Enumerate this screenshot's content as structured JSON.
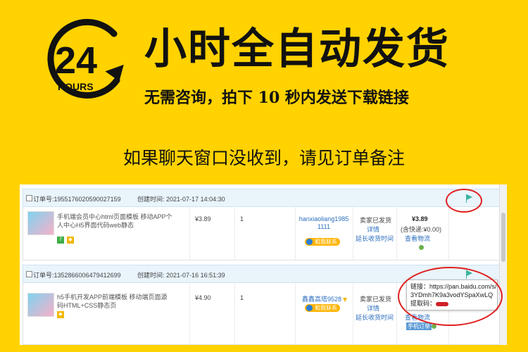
{
  "header": {
    "logo_number": "24",
    "logo_word": "HOURS",
    "headline": "小时全自动发货",
    "subline": "无需咨询，拍下 10 秒内发送下载链接",
    "note": "如果聊天窗口没收到，请见订单备注"
  },
  "orders": [
    {
      "order_label": "订单号:",
      "order_no": "1955176020590027159",
      "created_label": "创建时间:",
      "created_time": "2021-07-17 14:04:30",
      "product": "手机端会员中心html页面模板 移动APP个人中心H5界面代码web静态",
      "unit_price": "¥3.89",
      "quantity": "1",
      "buyer": "hanxiaoliang19851111",
      "contact_label": "和我联系",
      "status": "卖家已发货",
      "detail_link": "详情",
      "extend_link": "延长收货时间",
      "total": "¥3.89",
      "shipping_note": "(含快递:¥0.00)",
      "logistics_link": "查看物流"
    },
    {
      "order_label": "订单号:",
      "order_no": "1352866006479412699",
      "created_label": "创建时间:",
      "created_time": "2021-07-16 16:51:39",
      "product": "h5手机开发APP前端模板 移动端页面源码HTML+CSS静态页",
      "unit_price": "¥4.90",
      "quantity": "1",
      "buyer": "鑫鑫高塔9528",
      "contact_label": "和我联系",
      "status": "卖家已发货",
      "detail_link": "详情",
      "extend_link": "延长收货时间",
      "logistics_link": "查看物流",
      "extra_button": "手机订单"
    }
  ],
  "popup": {
    "link_label": "链接：",
    "link_url": "https://pan.baidu.com/s/1_3YDmh7K9a3vodYSpaXwLQ",
    "line1": "链接：https://pan.baidu.com/s/1_",
    "line2": "3YDmh7K9a3vodYSpaXwLQ",
    "code_label": "提取码："
  },
  "colors": {
    "background": "#ffd200",
    "text": "#111111",
    "link": "#2c6fbf",
    "highlight_circle": "#e02020",
    "flag": "#3bb5a0"
  },
  "icons": [
    "clock-arrow-icon",
    "flag-icon",
    "wangwang-chat-icon",
    "logistics-dot-icon"
  ]
}
